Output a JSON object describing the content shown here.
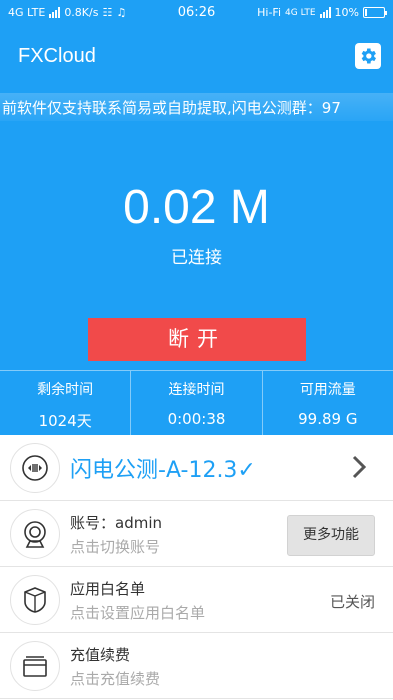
{
  "status_bar": {
    "network_left": "4G LTE",
    "net_speed": "0.8K/s",
    "time": "06:26",
    "wifi_label": "Hi-Fi",
    "network_right": "4G LTE",
    "battery": "10%",
    "battery_level": 0.1
  },
  "app": {
    "title": "FXCloud",
    "settings_icon": "gear-icon"
  },
  "notice": "前软件仅支持联系简易或自助提取,闪电公测群：97",
  "connection": {
    "speed": "0.02 M",
    "status": "已连接",
    "disconnect_label": "断开"
  },
  "stats": [
    {
      "label": "剩余时间",
      "value": "1024天"
    },
    {
      "label": "连接时间",
      "value": "0:00:38"
    },
    {
      "label": "可用流量",
      "value": "99.89 G"
    }
  ],
  "server": {
    "name": "闪电公测-A-12.3✓",
    "icon": "server-icon"
  },
  "account": {
    "title": "账号：admin",
    "subtitle": "点击切换账号",
    "more_button": "更多功能",
    "icon": "camera-icon"
  },
  "whitelist": {
    "title": "应用白名单",
    "subtitle": "点击设置应用白名单",
    "status": "已关闭",
    "icon": "shield-icon"
  },
  "recharge": {
    "title": "充值续费",
    "subtitle": "点击充值续费",
    "icon": "wallet-icon"
  },
  "colors": {
    "primary": "#1ea0f5",
    "danger": "#f14a4a"
  }
}
